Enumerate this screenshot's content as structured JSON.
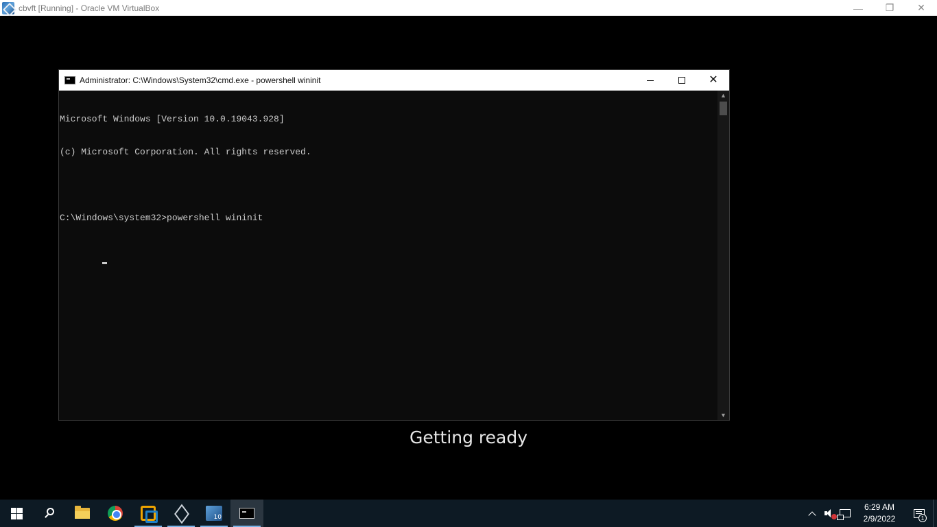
{
  "host": {
    "title": "cbvft [Running] - Oracle VM VirtualBox",
    "controls": {
      "minimize": "—",
      "restore": "❐",
      "close": "✕"
    }
  },
  "cmd_window": {
    "title": "Administrator: C:\\Windows\\System32\\cmd.exe - powershell  wininit",
    "lines": [
      "Microsoft Windows [Version 10.0.19043.928]",
      "(c) Microsoft Corporation. All rights reserved.",
      "",
      "C:\\Windows\\system32>powershell wininit"
    ],
    "close_glyph": "✕",
    "scroll_up": "▲",
    "scroll_down": "▼",
    "text_color": "#cccccc",
    "background": "#0c0c0c"
  },
  "status": {
    "message": "Getting ready"
  },
  "taskbar": {
    "apps": [
      {
        "name": "start",
        "icon": "windows-logo-icon"
      },
      {
        "name": "search",
        "icon": "search-icon"
      },
      {
        "name": "file-explorer",
        "icon": "folder-icon"
      },
      {
        "name": "chrome",
        "icon": "chrome-icon"
      },
      {
        "name": "vmware",
        "icon": "vmware-icon"
      },
      {
        "name": "virtualbox-cube",
        "icon": "cube-icon"
      },
      {
        "name": "virtualbox",
        "icon": "virtualbox-icon"
      },
      {
        "name": "command-prompt",
        "icon": "cmd-icon"
      }
    ],
    "clock": {
      "time": "6:29 AM",
      "date": "2/9/2022"
    },
    "notification_count": "1",
    "background": "#0d1a24"
  }
}
